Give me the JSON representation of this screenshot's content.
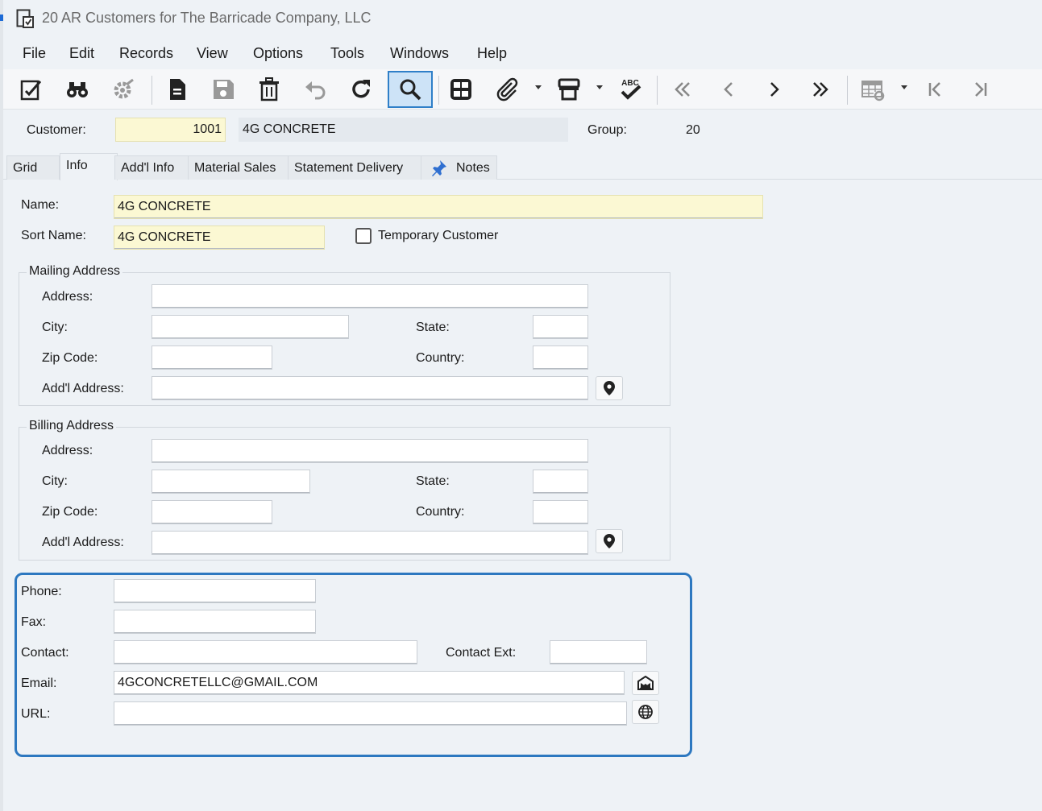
{
  "window": {
    "title": "20 AR Customers for The Barricade Company, LLC"
  },
  "menu": [
    "File",
    "Edit",
    "Records",
    "View",
    "Options",
    "Tools",
    "Windows",
    "Help"
  ],
  "toolbar": {
    "icons": [
      "edit-icon",
      "binoculars-icon",
      "settings-gear-icon",
      "new-document-icon",
      "save-icon",
      "delete-icon",
      "undo-icon",
      "refresh-icon",
      "search-icon",
      "grid-icon",
      "attachment-icon",
      "print-icon",
      "spell-check-icon",
      "first-page-icon",
      "previous-icon",
      "next-icon",
      "last-page-icon",
      "grid-settings-icon",
      "first-record-icon",
      "last-record-icon"
    ],
    "spell_check_label": "ABC"
  },
  "header": {
    "customer_label": "Customer:",
    "customer_number": "1001",
    "customer_name": "4G CONCRETE",
    "group_label": "Group:",
    "group_value": "20"
  },
  "tabs": [
    {
      "label": "Grid",
      "active": false
    },
    {
      "label": "Info",
      "active": true
    },
    {
      "label": "Add'l Info",
      "active": false
    },
    {
      "label": "Material Sales",
      "active": false
    },
    {
      "label": "Statement Delivery",
      "active": false
    },
    {
      "label": "Notes",
      "active": false
    }
  ],
  "info": {
    "name_label": "Name:",
    "name_value": "4G CONCRETE",
    "sort_name_label": "Sort Name:",
    "sort_name_value": "4G CONCRETE",
    "temporary_customer_label": "Temporary Customer",
    "temporary_customer_checked": false
  },
  "mailing": {
    "title": "Mailing Address",
    "address_label": "Address:",
    "address_value": "",
    "city_label": "City:",
    "city_value": "",
    "state_label": "State:",
    "state_value": "",
    "zip_label": "Zip Code:",
    "zip_value": "",
    "country_label": "Country:",
    "country_value": "",
    "addl_label": "Add'l Address:",
    "addl_value": ""
  },
  "billing": {
    "title": "Billing Address",
    "address_label": "Address:",
    "address_value": "",
    "city_label": "City:",
    "city_value": "",
    "state_label": "State:",
    "state_value": "",
    "zip_label": "Zip Code:",
    "zip_value": "",
    "country_label": "Country:",
    "country_value": "",
    "addl_label": "Add'l Address:",
    "addl_value": ""
  },
  "contact": {
    "phone_label": "Phone:",
    "phone_value": "",
    "fax_label": "Fax:",
    "fax_value": "",
    "contact_label": "Contact:",
    "contact_value": "",
    "contact_ext_label": "Contact Ext:",
    "contact_ext_value": "",
    "email_label": "Email:",
    "email_value": "4GCONCRETELLC@GMAIL.COM",
    "url_label": "URL:",
    "url_value": ""
  },
  "colors": {
    "highlight_border": "#2d78c0",
    "required_field": "#fbf8d3",
    "active_tool": "#cde3f7"
  }
}
